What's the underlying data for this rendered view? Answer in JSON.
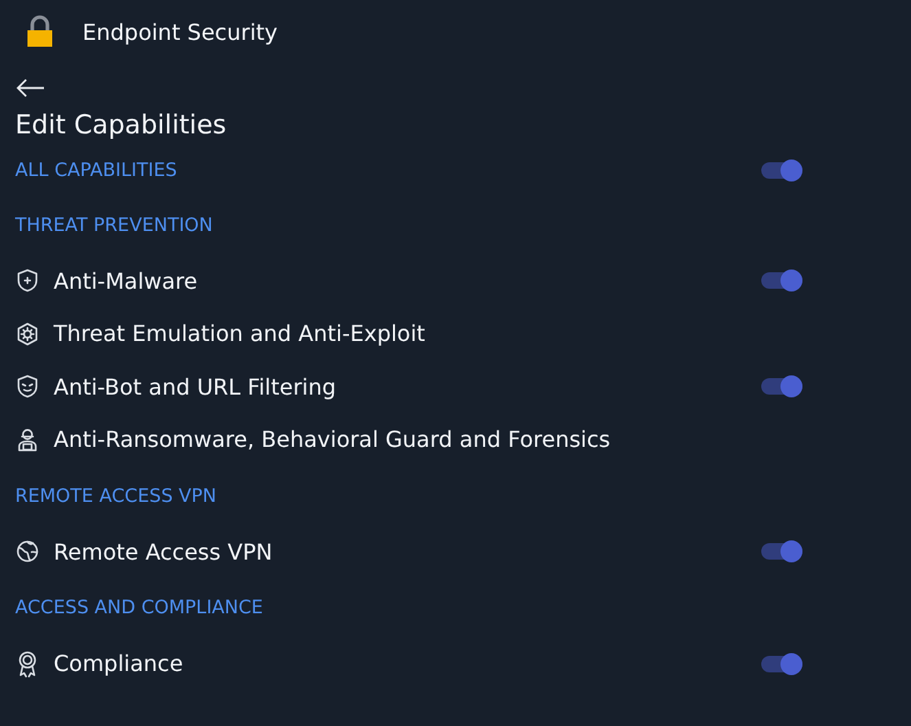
{
  "app": {
    "title": "Endpoint Security"
  },
  "page": {
    "title": "Edit Capabilities"
  },
  "all_capabilities": {
    "label": "ALL CAPABILITIES",
    "on": true
  },
  "sections": [
    {
      "title": "THREAT PREVENTION",
      "items": [
        {
          "label": "Anti-Malware",
          "on": true
        },
        {
          "label": "Threat Emulation and Anti-Exploit"
        },
        {
          "label": "Anti-Bot and URL Filtering",
          "on": true
        },
        {
          "label": "Anti-Ransomware, Behavioral Guard and Forensics"
        }
      ]
    },
    {
      "title": "REMOTE ACCESS VPN",
      "items": [
        {
          "label": "Remote Access VPN",
          "on": true
        }
      ]
    },
    {
      "title": "ACCESS AND COMPLIANCE",
      "items": [
        {
          "label": "Compliance",
          "on": true
        }
      ]
    }
  ]
}
